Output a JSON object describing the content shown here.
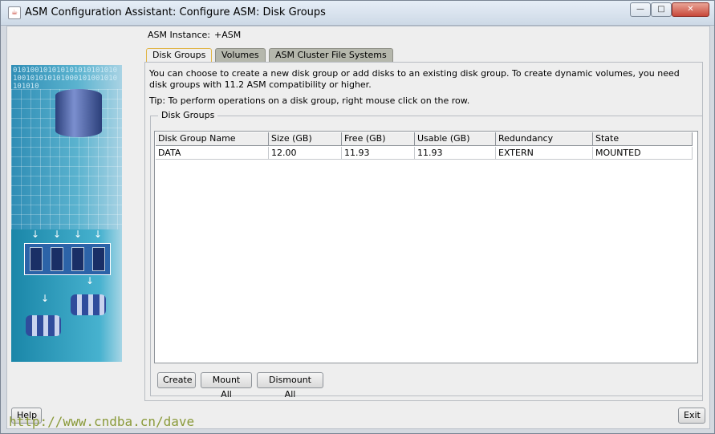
{
  "window": {
    "title": "ASM Configuration Assistant: Configure ASM: Disk Groups",
    "app_icon_glyph": "☕",
    "controls": {
      "minimize": "—",
      "maximize": "□",
      "close": "✕"
    }
  },
  "instance": {
    "label": "ASM Instance:",
    "value": "+ASM"
  },
  "tabs": [
    {
      "label": "Disk Groups",
      "active": true
    },
    {
      "label": "Volumes",
      "active": false
    },
    {
      "label": "ASM Cluster File Systems",
      "active": false
    }
  ],
  "description": "You can choose to create a new disk group or add disks to an existing disk group. To create dynamic volumes, you need disk groups with 11.2 ASM compatibility or higher.",
  "tip": "Tip: To perform operations on a disk group, right mouse click on the row.",
  "disk_groups": {
    "title": "Disk Groups",
    "columns": [
      "Disk Group Name",
      "Size (GB)",
      "Free (GB)",
      "Usable (GB)",
      "Redundancy",
      "State"
    ],
    "rows": [
      [
        "DATA",
        "12.00",
        "11.93",
        "11.93",
        "EXTERN",
        "MOUNTED"
      ]
    ]
  },
  "buttons": {
    "create": "Create",
    "mount_all": "Mount All",
    "dismount_all": "Dismount All",
    "help": "Help",
    "exit": "Exit"
  },
  "watermark": "http://www.cndba.cn/dave",
  "side_binary": "010100101010101010101010100101010101000101001010101010",
  "colors": {
    "active_tab_border": "#e0b444",
    "tab_inactive": "#b5b7ac",
    "side_panel": "#2f8db5"
  }
}
